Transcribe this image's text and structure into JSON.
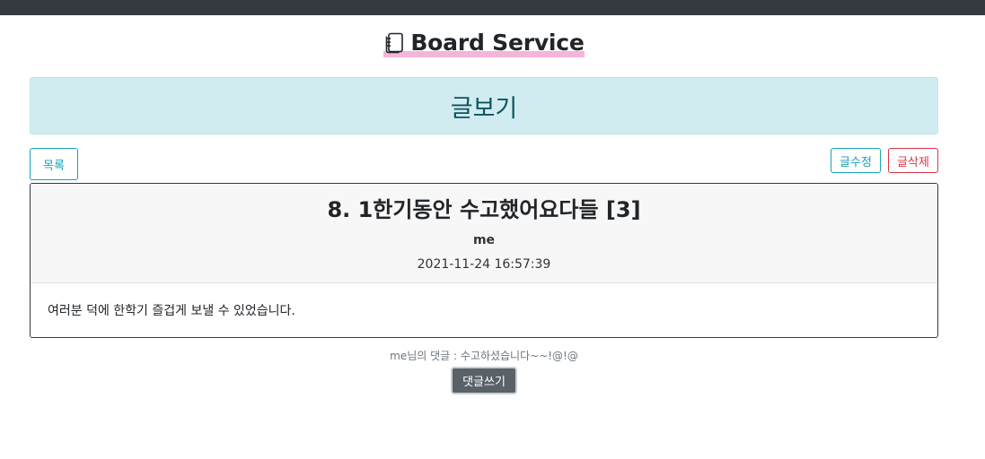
{
  "brand": {
    "title": "Board Service",
    "icon": "notebook-icon"
  },
  "banner": {
    "title": "글보기",
    "bg": "#d1ecf1",
    "color": "#0c5460"
  },
  "toolbar": {
    "list_label": "목록",
    "edit_label": "글수정",
    "delete_label": "글삭제"
  },
  "post": {
    "title": "8. 1한기동안 수고했어요다들 [3]",
    "author": "me",
    "date": "2021-11-24 16:57:39",
    "body": "여러분 덕에 한학기 즐겁게 보낼 수 있었습니다."
  },
  "comments": [
    {
      "author": "me",
      "separator": "님의 댓글 : ",
      "text": "수고하셨습니다~~!@!@"
    }
  ],
  "comment_button": {
    "label": "댓글쓰기"
  },
  "colors": {
    "info": "#17a2b8",
    "danger": "#dc3545",
    "topbar": "#343a40",
    "highlight": "#f7b3da"
  }
}
